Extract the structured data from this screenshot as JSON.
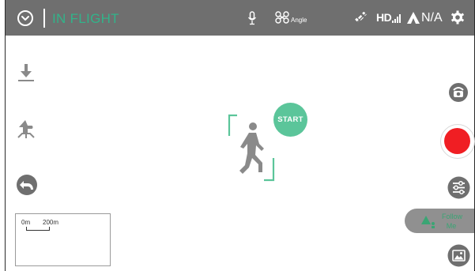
{
  "status_bar": {
    "flight_status": "IN FLIGHT",
    "mode_label": "Angle",
    "signal_label": "HD",
    "gps_value": "N/A",
    "status_color": "#32b38a",
    "bar_color": "#6f6f6f"
  },
  "tracking": {
    "start_label": "START",
    "follow_label": "Follow Me"
  },
  "minimap": {
    "scale_start": "0m",
    "scale_end": "200m"
  },
  "colors": {
    "accent": "#5bc59a",
    "record": "#f01e23",
    "icon": "#6f6f6f"
  }
}
